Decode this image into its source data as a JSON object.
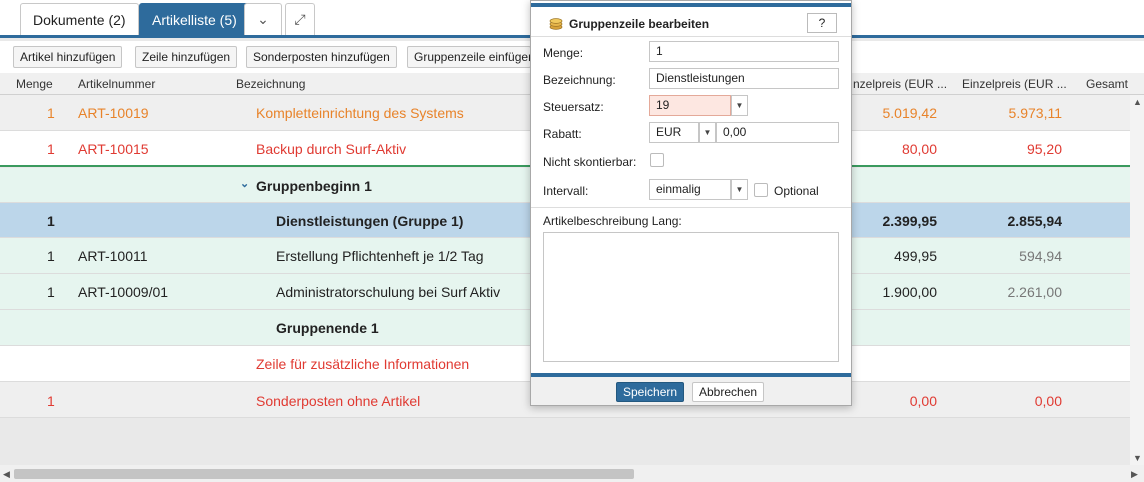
{
  "tabs": [
    {
      "label": "Dokumente (2)"
    },
    {
      "label": "Artikelliste (5)"
    }
  ],
  "toolbar": {
    "add_article": "Artikel hinzufügen",
    "add_line": "Zeile hinzufügen",
    "add_special": "Sonderposten hinzufügen",
    "add_group": "Gruppenzeile einfügen"
  },
  "columns": {
    "menge": "Menge",
    "artikelnummer": "Artikelnummer",
    "bezeichnung": "Bezeichnung",
    "einzelpreis_netto": "nzelpreis (EUR ...",
    "einzelpreis_brutto": "Einzelpreis (EUR ...",
    "gesamt": "Gesamt"
  },
  "rows": [
    {
      "menge": "1",
      "artnr": "ART-10019",
      "bez": "Komplettеinrichtung des Systems",
      "preis1": "5.019,42",
      "preis2": "5.973,11"
    },
    {
      "menge": "1",
      "artnr": "ART-10015",
      "bez": "Backup durch Surf-Aktiv",
      "preis1": "80,00",
      "preis2": "95,20"
    },
    {
      "menge": "",
      "artnr": "",
      "bez": "Gruppenbeginn 1",
      "preis1": "",
      "preis2": ""
    },
    {
      "menge": "1",
      "artnr": "",
      "bez": "Dienstleistungen (Gruppe 1)",
      "preis1": "2.399,95",
      "preis2": "2.855,94"
    },
    {
      "menge": "1",
      "artnr": "ART-10011",
      "bez": "Erstellung Pflichtenheft je 1/2 Tag",
      "preis1": "499,95",
      "preis2": "594,94"
    },
    {
      "menge": "1",
      "artnr": "ART-10009/01",
      "bez": "Administratorschulung bei Surf Aktiv",
      "preis1": "1.900,00",
      "preis2": "2.261,00"
    },
    {
      "menge": "",
      "artnr": "",
      "bez": "Gruppenende 1",
      "preis1": "",
      "preis2": ""
    },
    {
      "menge": "",
      "artnr": "",
      "bez": "Zeile für zusätzliche Informationen",
      "preis1": "",
      "preis2": ""
    },
    {
      "menge": "1",
      "artnr": "",
      "bez": "Sonderposten ohne Artikel",
      "preis1": "0,00",
      "preis2": "0,00"
    }
  ],
  "dialog": {
    "title": "Gruppenzeile bearbeiten",
    "help": "?",
    "menge_label": "Menge:",
    "menge_value": "1",
    "bez_label": "Bezeichnung:",
    "bez_value": "Dienstleistungen",
    "steuer_label": "Steuersatz:",
    "steuer_value": "19",
    "rabatt_label": "Rabatt:",
    "rabatt_currency": "EUR",
    "rabatt_value": "0,00",
    "skonto_label": "Nicht skontierbar:",
    "intervall_label": "Intervall:",
    "intervall_value": "einmalig",
    "optional_label": "Optional",
    "beschreibung_label": "Artikelbeschreibung Lang:",
    "save": "Speichern",
    "cancel": "Abbrechen"
  },
  "colors": {
    "accent": "#2e6b9c",
    "orange_text": "#e8832a",
    "red_text": "#e03a32",
    "group_bg": "#e6f5ef",
    "selected_bg": "#bcd6ea",
    "steuer_bg": "#fde7e1"
  }
}
